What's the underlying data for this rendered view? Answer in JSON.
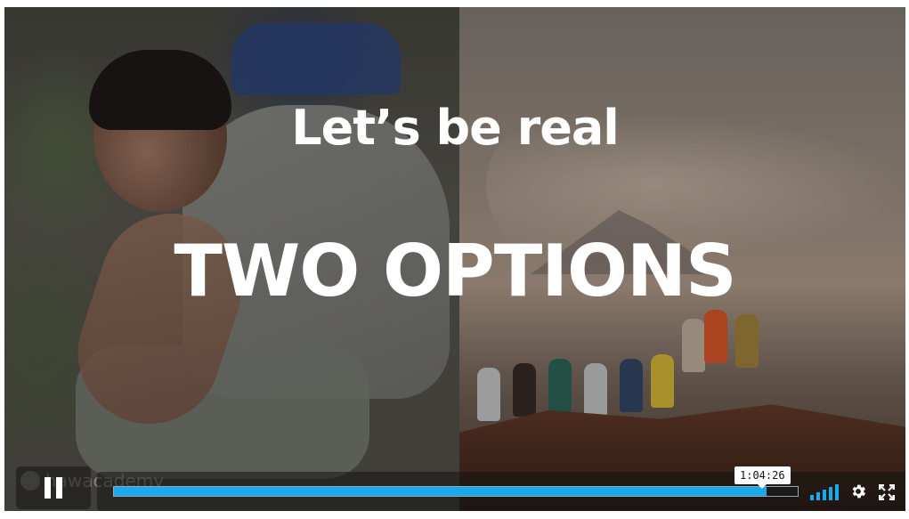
{
  "video": {
    "headline_small": "Let’s be real",
    "headline_big": "TWO OPTIONS",
    "watermark": "hawacademy"
  },
  "player": {
    "play_state": "playing",
    "hover_time": "1:04:26",
    "progress_fraction": 0.955,
    "volume_level": 5,
    "colors": {
      "accent": "#19aaed",
      "bar_bg": "#1a1a1a",
      "icon": "#ffffff"
    },
    "icons": {
      "pause": "pause-icon",
      "volume": "volume-bars-icon",
      "settings": "gear-icon",
      "fullscreen": "fullscreen-icon"
    }
  }
}
